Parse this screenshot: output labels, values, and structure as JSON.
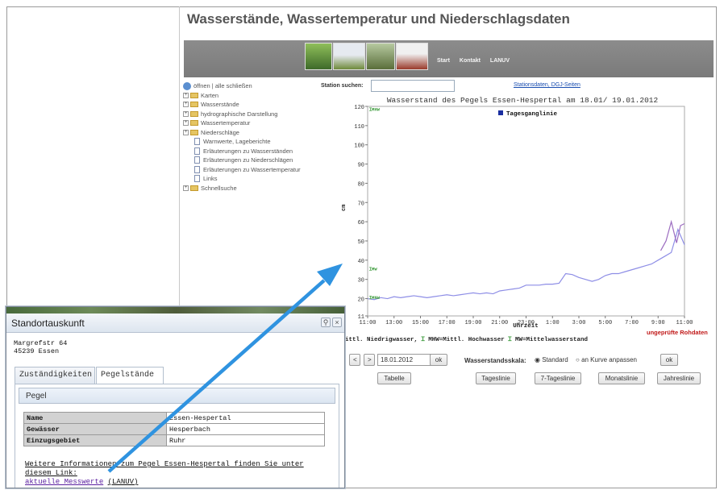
{
  "page": {
    "title": "Wasserstände, Wassertemperatur und Niederschlagsdaten"
  },
  "nav": {
    "links": [
      "Start",
      "Kontakt",
      "LANUV"
    ]
  },
  "tree": {
    "header": "öffnen | alle schließen",
    "folders": [
      "Karten",
      "Wasserstände",
      "hydrographische Darstellung",
      "Wassertemperatur",
      "Niederschläge"
    ],
    "docs": [
      "Warnwerte, Lageberichte",
      "Erläuterungen zu Wasserständen",
      "Erläuterungen zu Niederschlägen",
      "Erläuterungen zu Wassertemperatur",
      "Links"
    ],
    "last_folder": "Schnellsuche"
  },
  "search": {
    "label": "Station suchen:",
    "value": ""
  },
  "station_link": "Stationsdaten, DGJ-Seiten",
  "chart_data": {
    "type": "line",
    "title": "Wasserstand des Pegels Essen-Hespertal am 18.01/ 19.01.2012",
    "xlabel": "Uhrzeit",
    "ylabel": "cm",
    "ylim": [
      11,
      120
    ],
    "yticks": [
      11,
      20,
      30,
      40,
      50,
      60,
      70,
      80,
      90,
      100,
      110,
      120
    ],
    "xticks": [
      "11:00",
      "13:00",
      "15:00",
      "17:00",
      "19:00",
      "21:00",
      "23:00",
      "1:00",
      "3:00",
      "5:00",
      "7:00",
      "9:00",
      "11:00"
    ],
    "legend": "top-center",
    "series": [
      {
        "name": "Tagesganglinie",
        "color": "#8e8ee6",
        "x": [
          0,
          0.5,
          1,
          1.5,
          2,
          2.5,
          3,
          3.5,
          4,
          4.5,
          5,
          5.5,
          6,
          6.5,
          7,
          7.5,
          8,
          8.5,
          9,
          9.5,
          10,
          10.5,
          11,
          11.5,
          12,
          12.5,
          13,
          13.5,
          14,
          14.5,
          15,
          15.5,
          16,
          16.5,
          17,
          17.5,
          18,
          18.5,
          19,
          19.5,
          20,
          20.5,
          21,
          21.5,
          22,
          22.5,
          23,
          23.5,
          24
        ],
        "y": [
          20,
          19.5,
          20.5,
          20,
          21,
          20.5,
          21,
          21.5,
          21,
          20.5,
          21,
          21.5,
          22,
          21.5,
          22,
          22.5,
          23,
          22.5,
          23,
          22.5,
          24,
          24.5,
          25,
          25.5,
          27,
          27,
          27,
          27.5,
          27.5,
          28,
          33,
          32.5,
          31,
          30,
          29,
          30,
          32,
          33,
          33,
          34,
          35,
          36,
          37,
          38,
          40,
          42,
          44,
          56,
          48
        ]
      },
      {
        "name": "",
        "color": "#9c6cc0",
        "x": [
          22.2,
          22.6,
          23,
          23.4,
          23.7,
          24
        ],
        "y": [
          45,
          50,
          60,
          49,
          58,
          59
        ]
      }
    ],
    "markers": [
      {
        "label": "MHW",
        "y": 119
      },
      {
        "label": "MW",
        "y": 36
      },
      {
        "label": "MNW",
        "y": 21
      }
    ]
  },
  "legend_row": {
    "text": "ittl. Niedrigwasser",
    "mhw": "MHW=Mittl. Hochwasser",
    "mw": "MW=Mittelwasserstand"
  },
  "rohdaten": "ungeprüfte Rohdaten",
  "controls": {
    "prev": "<",
    "next": ">",
    "date": "18.01.2012",
    "ok": "ok",
    "scale_label": "Wasserstandsskala:",
    "opt_standard": "Standard",
    "opt_curve": "an Kurve anpassen",
    "ok2": "ok",
    "tabelle": "Tabelle",
    "tagesl": "Tageslinie",
    "tage7": "7-Tageslinie",
    "monat": "Monatslinie",
    "jahr": "Jahreslinie"
  },
  "popup": {
    "title": "Standortauskunft",
    "address1": "Margrefstr 64",
    "address2": "45239 Essen",
    "tabs": [
      "Zuständigkeiten",
      "Pegelstände"
    ],
    "section": "Pegel",
    "rows": [
      {
        "k": "Name",
        "v": "Essen-Hespertal"
      },
      {
        "k": "Gewässer",
        "v": "Hesperbach"
      },
      {
        "k": "Einzugsgebiet",
        "v": "Ruhr"
      }
    ],
    "info_line1": "Weitere Informationen zum Pegel Essen-Hespertal finden Sie unter",
    "info_line2": "diesem Link:",
    "link_text": "aktuelle Messwerte",
    "link_suffix": "(LANUV)"
  },
  "colors": {
    "arrow": "#2f93e0",
    "series": "#8e8ee6",
    "link": "#1a4eb0"
  }
}
